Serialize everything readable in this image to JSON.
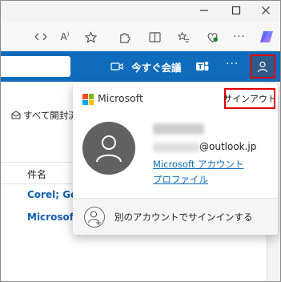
{
  "header": {
    "meet_now_label": "今すぐ会議",
    "more_label": "···"
  },
  "main": {
    "mark_all_read_label": "すべて開封済",
    "column_subject_label": "件名",
    "rows": [
      {
        "sender": "Corel; Goog"
      },
      {
        "sender": "Microsoft ア"
      }
    ]
  },
  "account_popup": {
    "brand_label": "Microsoft",
    "sign_out_label": "サインアウト",
    "email_domain": "@outlook.jp",
    "microsoft_account_link": "Microsoft アカウント",
    "profile_link": "プロファイル",
    "other_account_label": "別のアカウントでサインインする"
  },
  "colors": {
    "outlook_blue": "#0f6cbd",
    "highlight_red": "#e00000",
    "avatar_gray": "#616161"
  }
}
